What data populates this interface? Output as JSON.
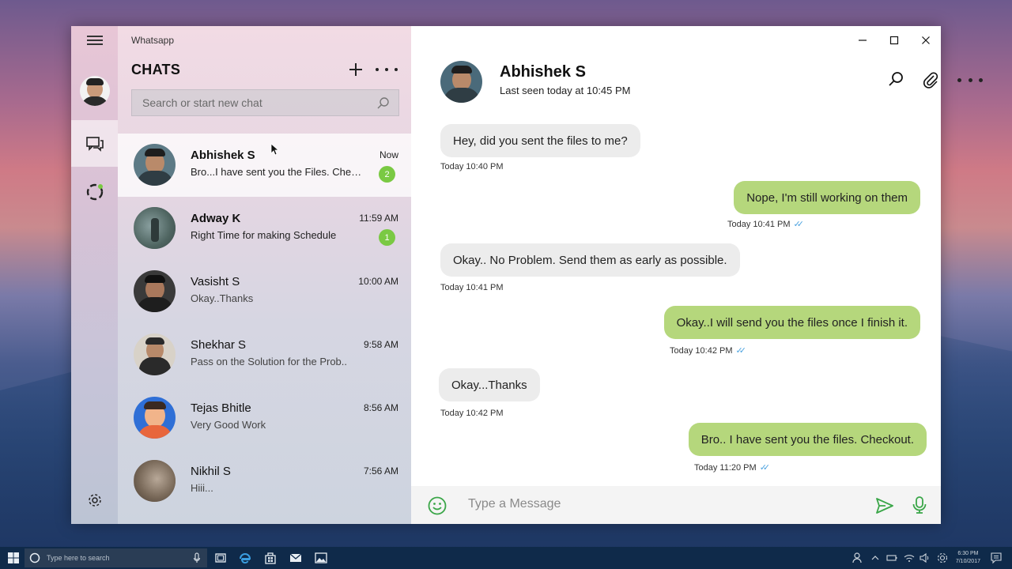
{
  "app": {
    "title": "Whatsapp",
    "chats_heading": "CHATS"
  },
  "search": {
    "placeholder": "Search or start new chat"
  },
  "chats": [
    {
      "name": "Abhishek S",
      "preview": "Bro...I have sent you the Files. Check...",
      "time": "Now",
      "unread": "2"
    },
    {
      "name": "Adway K",
      "preview": "Right Time for making Schedule",
      "time": "11:59 AM",
      "unread": "1"
    },
    {
      "name": "Vasisht S",
      "preview": "Okay..Thanks",
      "time": "10:00 AM"
    },
    {
      "name": "Shekhar S",
      "preview": "Pass on the Solution for the Prob..",
      "time": "9:58 AM"
    },
    {
      "name": "Tejas Bhitle",
      "preview": "Very Good Work",
      "time": "8:56 AM"
    },
    {
      "name": "Nikhil S",
      "preview": "Hiii...",
      "time": "7:56 AM"
    }
  ],
  "conversation": {
    "contact_name": "Abhishek S",
    "last_seen": "Last seen today at 10:45 PM",
    "messages": [
      {
        "direction": "in",
        "text": "Hey, did you sent the files to me?",
        "time": "Today 10:40 PM"
      },
      {
        "direction": "out",
        "text": "Nope, I'm still working on them",
        "time": "Today 10:41 PM"
      },
      {
        "direction": "in",
        "text": "Okay.. No Problem. Send them as early as possible.",
        "time": "Today 10:41 PM"
      },
      {
        "direction": "out",
        "text": "Okay..I will send you the files once I finish it.",
        "time": "Today 10:42 PM"
      },
      {
        "direction": "in",
        "text": "Okay...Thanks",
        "time": "Today 10:42 PM"
      },
      {
        "direction": "out",
        "text": "Bro.. I have sent you the files. Checkout.",
        "time": "Today 11:20 PM"
      }
    ],
    "compose_placeholder": "Type a Message"
  },
  "taskbar": {
    "search_placeholder": "Type here to search",
    "clock_time": "6:30 PM",
    "clock_date": "7/10/2017"
  },
  "colors": {
    "outgoing_bubble": "#b5d77c",
    "incoming_bubble": "#ececec",
    "unread_badge": "#7ac943",
    "read_ticks": "#4da3e0"
  }
}
